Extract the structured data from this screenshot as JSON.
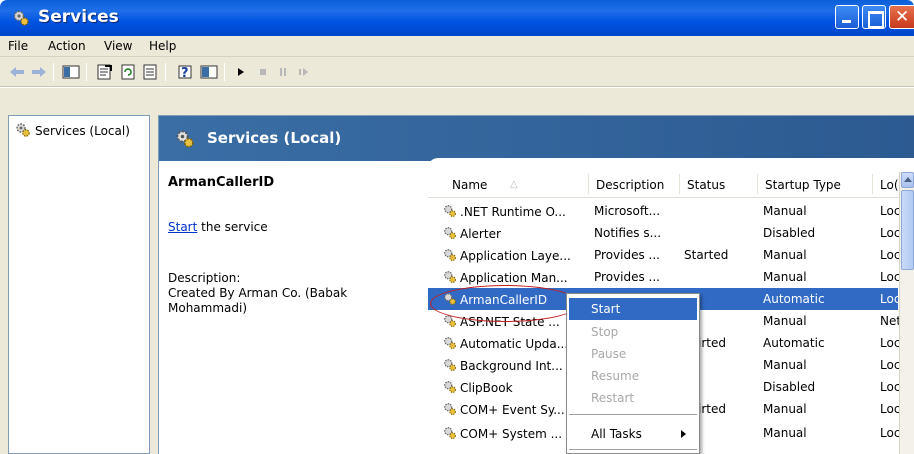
{
  "window": {
    "title": "Services"
  },
  "menu": [
    "File",
    "Action",
    "View",
    "Help"
  ],
  "toolbar": {
    "icons": [
      "back-icon",
      "forward-icon",
      "show-hide-tree-icon",
      "properties-icon",
      "refresh-icon",
      "export-list-icon",
      "help-icon",
      "show-hide-action-pane-icon",
      "play-icon",
      "stop-icon",
      "pause-icon",
      "restart-icon"
    ]
  },
  "tree": {
    "item": "Services (Local)"
  },
  "banner": {
    "title": "Services (Local)"
  },
  "details": {
    "service_name": "ArmanCallerID",
    "start_link": "Start",
    "start_suffix": " the service",
    "description_label": "Description:",
    "description_text": "Created By Arman Co. (Babak Mohammadi)"
  },
  "columns": [
    "Name",
    "Description",
    "Status",
    "Startup Type",
    "Lo("
  ],
  "rows": [
    {
      "name": ".NET Runtime O...",
      "description": "Microsoft...",
      "status": "",
      "startup": "Manual",
      "logon": "Loc"
    },
    {
      "name": "Alerter",
      "description": "Notifies s...",
      "status": "",
      "startup": "Disabled",
      "logon": "Loc"
    },
    {
      "name": "Application Laye...",
      "description": "Provides ...",
      "status": "Started",
      "startup": "Manual",
      "logon": "Loc"
    },
    {
      "name": "Application Man...",
      "description": "Provides ...",
      "status": "",
      "startup": "Manual",
      "logon": "Loc"
    },
    {
      "name": "ArmanCallerID",
      "description": "",
      "status": "",
      "startup": "Automatic",
      "logon": "Loc"
    },
    {
      "name": "ASP.NET State ...",
      "description": "",
      "status": "",
      "startup": "Manual",
      "logon": "Net"
    },
    {
      "name": "Automatic Upda...",
      "description": "",
      "status": "irted",
      "startup": "Automatic",
      "logon": "Loc"
    },
    {
      "name": "Background Int...",
      "description": "",
      "status": "",
      "startup": "Manual",
      "logon": "Loc"
    },
    {
      "name": "ClipBook",
      "description": "",
      "status": "",
      "startup": "Disabled",
      "logon": "Loc"
    },
    {
      "name": "COM+ Event Sy...",
      "description": "",
      "status": "irted",
      "startup": "Manual",
      "logon": "Loc"
    },
    {
      "name": "COM+ System ...",
      "description": "",
      "status": "",
      "startup": "Manual",
      "logon": "Loc"
    }
  ],
  "context_menu": {
    "start": "Start",
    "stop": "Stop",
    "pause": "Pause",
    "resume": "Resume",
    "restart": "Restart",
    "all_tasks": "All Tasks"
  },
  "colors": {
    "selection": "#316ac5",
    "banner": "#3a6ea5",
    "titlebar": "#0054e3"
  }
}
